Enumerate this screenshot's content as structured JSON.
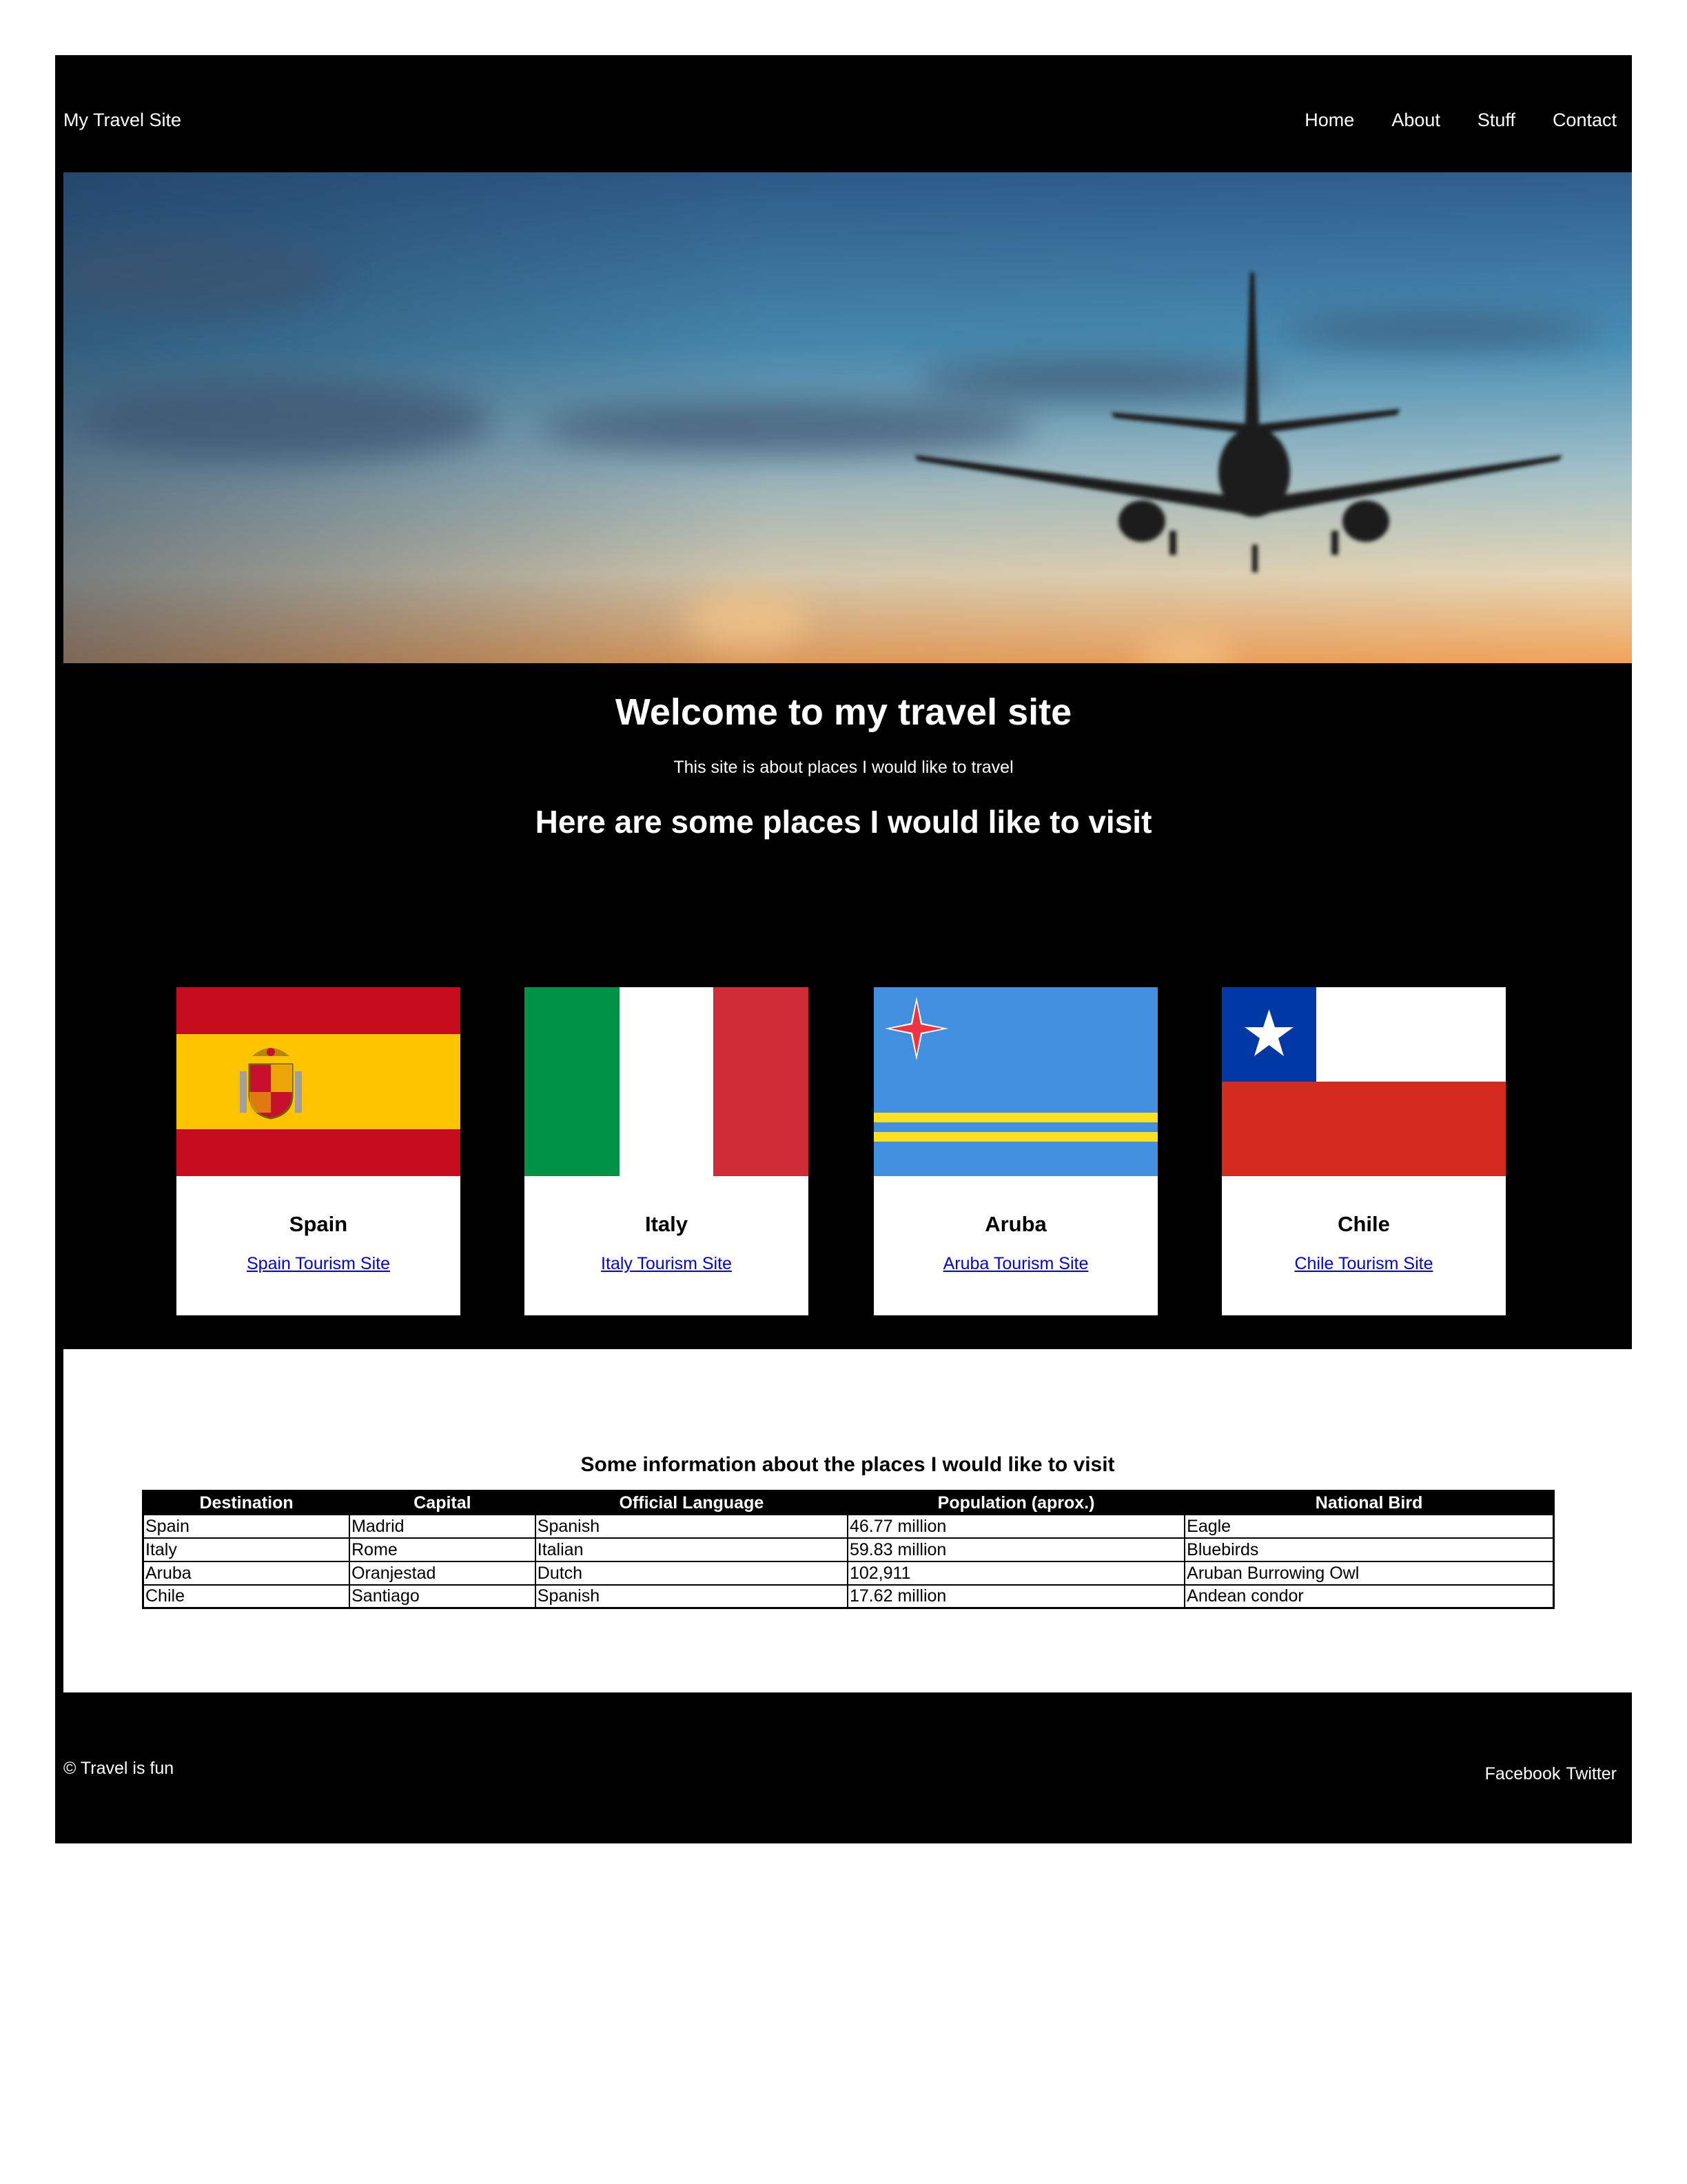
{
  "header": {
    "site_title": "My Travel Site",
    "nav": [
      "Home",
      "About",
      "Stuff",
      "Contact"
    ]
  },
  "hero": {
    "image": "airplane-landing-sunset-photo"
  },
  "intro": {
    "welcome": "Welcome to my travel site",
    "subtitle": "This site is about places I would like to travel",
    "places_heading": "Here are some places I would like to visit"
  },
  "cards": [
    {
      "name": "Spain",
      "link": "Spain Tourism Site",
      "flag": "spain-flag"
    },
    {
      "name": "Italy",
      "link": "Italy Tourism Site",
      "flag": "italy-flag"
    },
    {
      "name": "Aruba",
      "link": "Aruba Tourism Site",
      "flag": "aruba-flag"
    },
    {
      "name": "Chile",
      "link": "Chile Tourism Site",
      "flag": "chile-flag"
    }
  ],
  "info": {
    "heading": "Some information about the places I would like to visit",
    "columns": [
      "Destination",
      "Capital",
      "Official Language",
      "Population (aprox.)",
      "National Bird"
    ],
    "rows": [
      [
        "Spain",
        "Madrid",
        "Spanish",
        "46.77 million",
        "Eagle"
      ],
      [
        "Italy",
        "Rome",
        "Italian",
        "59.83 million",
        "Bluebirds"
      ],
      [
        "Aruba",
        "Oranjestad",
        "Dutch",
        "102,911",
        "Aruban Burrowing Owl"
      ],
      [
        "Chile",
        "Santiago",
        "Spanish",
        "17.62 million",
        "Andean condor"
      ]
    ]
  },
  "footer": {
    "copyright": "© Travel is fun",
    "social": [
      "Facebook",
      "Twitter"
    ]
  },
  "colors": {
    "page_background": "#000000",
    "link": "#0000ee",
    "spain_red": "#c60b1e",
    "spain_yellow": "#ffc400",
    "italy_green": "#009246",
    "italy_red": "#ce2b37",
    "aruba_blue": "#418fde",
    "aruba_yellow": "#fbe122",
    "chile_blue": "#0039a6",
    "chile_red": "#d52b1e"
  }
}
